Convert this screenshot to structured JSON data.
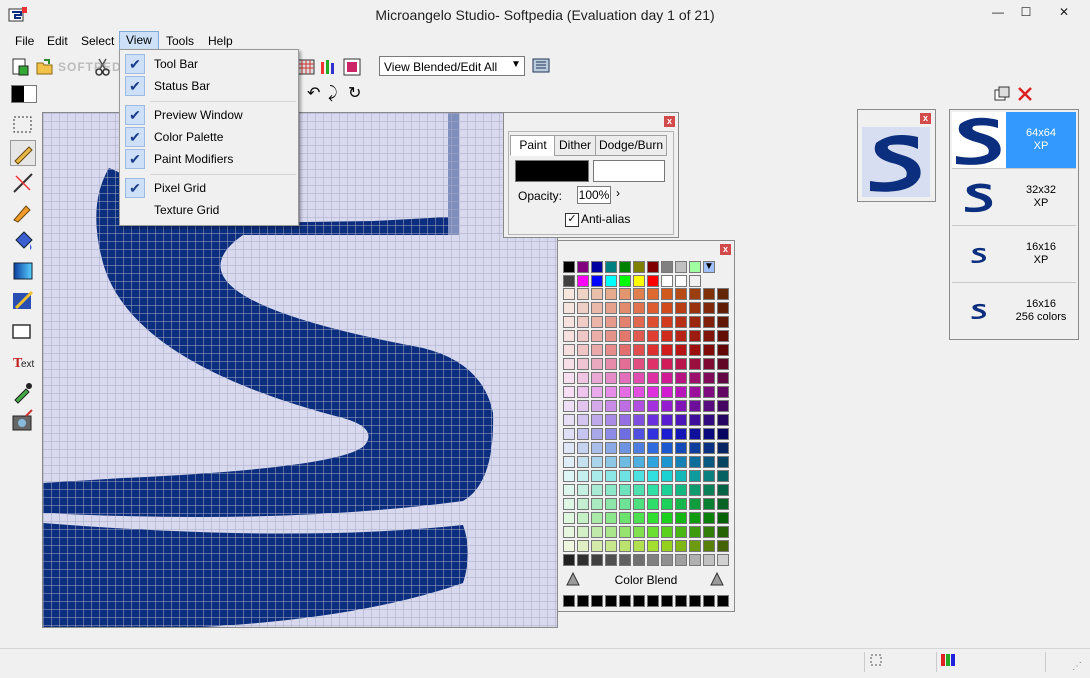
{
  "window": {
    "title": "Microangelo Studio- Softpedia  (Evaluation day 1 of 21)",
    "minimize": "—",
    "maximize": "☐",
    "close": "✕"
  },
  "menu": {
    "items": [
      "File",
      "Edit",
      "Select",
      "View",
      "Tools",
      "Help"
    ]
  },
  "toolbar": {
    "view_mode_value": "View Blended/Edit All",
    "watermark": "SOFTPEDIA"
  },
  "view_menu": {
    "items": [
      {
        "label": "Tool Bar",
        "checked": true
      },
      {
        "label": "Status Bar",
        "checked": true
      },
      {
        "label": "Preview Window",
        "checked": true
      },
      {
        "label": "Color Palette",
        "checked": true
      },
      {
        "label": "Paint Modifiers",
        "checked": true
      },
      {
        "label": "Pixel Grid",
        "checked": true
      },
      {
        "label": "Texture Grid",
        "checked": false
      }
    ]
  },
  "paint_panel": {
    "tabs": [
      "Paint",
      "Dither",
      "Dodge/Burn"
    ],
    "active_tab": "Paint",
    "opacity_label": "Opacity:",
    "opacity_value": "100%",
    "antialias_label": "Anti-alias",
    "antialias_checked": true
  },
  "palette_panel": {
    "blend_label": "Color Blend"
  },
  "formats": [
    {
      "size": "64x64",
      "depth": "XP",
      "selected": true
    },
    {
      "size": "32x32",
      "depth": "XP",
      "selected": false
    },
    {
      "size": "16x16",
      "depth": "XP",
      "selected": false
    },
    {
      "size": "16x16",
      "depth": "256 colors",
      "selected": false
    }
  ],
  "colors": {
    "icon_blue": "#0b2f7e",
    "grid_light": "#d8d9ee",
    "selection": "#3399ff"
  }
}
